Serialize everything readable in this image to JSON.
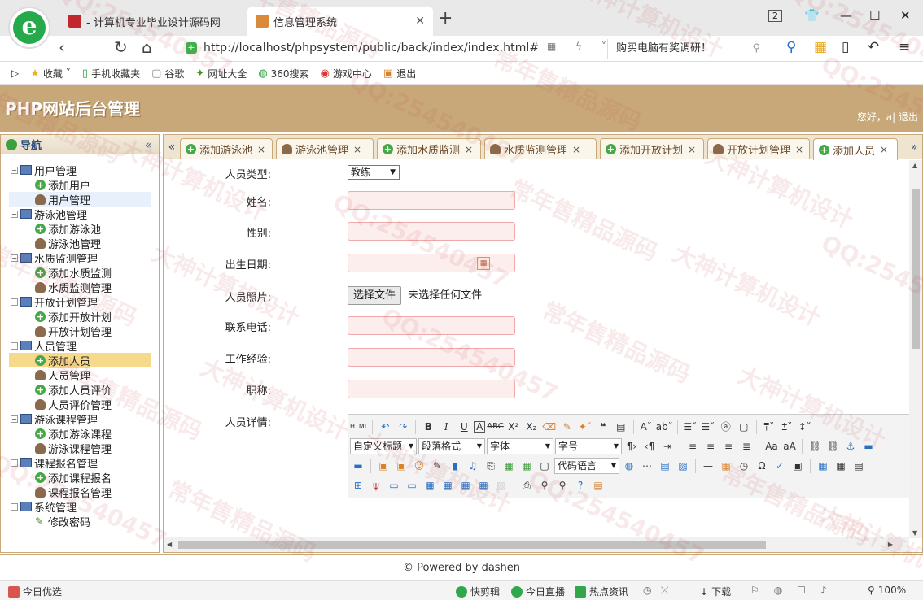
{
  "browser": {
    "tabs": [
      {
        "title": "- 计算机专业毕业设计源码网"
      },
      {
        "title": "信息管理系统"
      }
    ],
    "tab_count": "2",
    "url_host": "http://localhost",
    "url_path": "/phpsystem/public/back/index/index.html#",
    "search_text": "购买电脑有奖调研！",
    "bookmarks": [
      "收藏",
      "手机收藏夹",
      "谷歌",
      "网址大全",
      "360搜索",
      "游戏中心",
      "退出"
    ]
  },
  "header": {
    "title": "PHP网站后台管理",
    "greeting": "您好，a",
    "logout": "退出"
  },
  "sidebar": {
    "title": "导航",
    "groups": [
      {
        "label": "用户管理",
        "items": [
          "添加用户",
          "用户管理"
        ]
      },
      {
        "label": "游泳池管理",
        "items": [
          "添加游泳池",
          "游泳池管理"
        ]
      },
      {
        "label": "水质监测管理",
        "items": [
          "添加水质监测",
          "水质监测管理"
        ]
      },
      {
        "label": "开放计划管理",
        "items": [
          "添加开放计划",
          "开放计划管理"
        ]
      },
      {
        "label": "人员管理",
        "items": [
          "添加人员",
          "人员管理",
          "添加人员评价",
          "人员评价管理"
        ]
      },
      {
        "label": "游泳课程管理",
        "items": [
          "添加游泳课程",
          "游泳课程管理"
        ]
      },
      {
        "label": "课程报名管理",
        "items": [
          "添加课程报名",
          "课程报名管理"
        ]
      },
      {
        "label": "系统管理",
        "items": [
          "修改密码"
        ]
      }
    ]
  },
  "tabs": [
    "添加游泳池",
    "游泳池管理",
    "添加水质监测",
    "水质监测管理",
    "添加开放计划",
    "开放计划管理",
    "添加人员"
  ],
  "form": {
    "type_label": "人员类型:",
    "type_value": "教练",
    "name_label": "姓名:",
    "gender_label": "性别:",
    "birth_label": "出生日期:",
    "photo_label": "人员照片:",
    "file_button": "选择文件",
    "file_status": "未选择任何文件",
    "phone_label": "联系电话:",
    "experience_label": "工作经验:",
    "title_label": "职称:",
    "detail_label": "人员详情:"
  },
  "editor": {
    "heading_select": "自定义标题",
    "paragraph_select": "段落格式",
    "font_select": "字体",
    "size_select": "字号",
    "code_select": "代码语言"
  },
  "footer": {
    "text": "© Powered by dashen"
  },
  "statusbar": {
    "left": "今日优选",
    "items": [
      "快剪辑",
      "今日直播",
      "热点资讯",
      "下载"
    ],
    "zoom": "100%"
  },
  "watermark": {
    "texts": [
      "QQ:254540457",
      "常年售精品源码",
      "大神计算机设计"
    ]
  },
  "colors": {
    "header_bg": "#c8a878",
    "selected_bg": "#f6d98a",
    "input_border": "#f0a8a8"
  }
}
